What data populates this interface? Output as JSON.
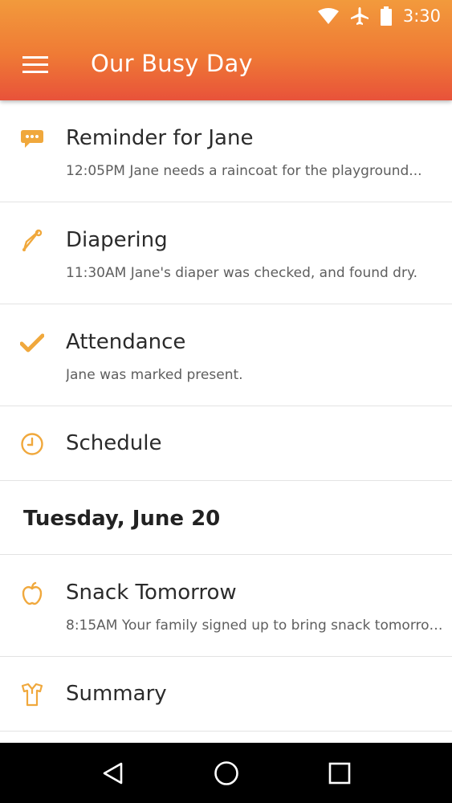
{
  "status_bar": {
    "time": "3:30",
    "icons": [
      "wifi-icon",
      "airplane-icon",
      "battery-icon"
    ]
  },
  "app_bar": {
    "title": "Our Busy Day",
    "menu_icon": "hamburger-menu-icon"
  },
  "feed": {
    "items": [
      {
        "icon": "chat-bubble-icon",
        "title": "Reminder for Jane",
        "subtitle": "12:05PM Jane needs a raincoat for the playground..."
      },
      {
        "icon": "safety-pin-icon",
        "title": "Diapering",
        "subtitle": "11:30AM Jane's diaper was checked, and found dry."
      },
      {
        "icon": "checkmark-icon",
        "title": "Attendance",
        "subtitle": "Jane was marked present."
      },
      {
        "icon": "clock-icon",
        "title": "Schedule"
      }
    ],
    "date_header": "Tuesday, June 20",
    "items_after": [
      {
        "icon": "apple-icon",
        "title": "Snack Tomorrow",
        "subtitle": "8:15AM Your family signed up to bring snack tomorrow, ..."
      },
      {
        "icon": "shirt-icon",
        "title": "Summary"
      }
    ]
  },
  "nav_bar": {
    "buttons": [
      "back-triangle-icon",
      "home-circle-icon",
      "recents-square-icon"
    ]
  },
  "colors": {
    "accent": "#f0a83c",
    "appbar_top": "#f29a3c",
    "appbar_bottom": "#e8523a"
  }
}
